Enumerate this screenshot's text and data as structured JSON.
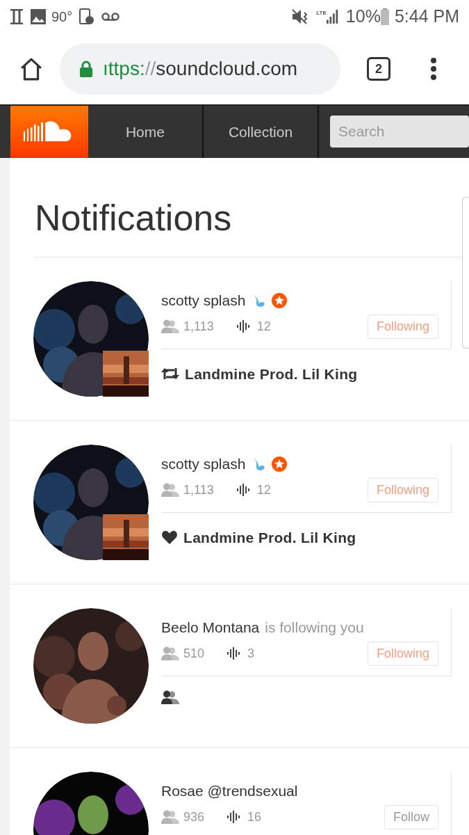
{
  "status_bar": {
    "temperature": "90°",
    "network": "LTE",
    "battery": "10%",
    "time": "5:44 PM"
  },
  "browser": {
    "url_scheme": "ıttps:",
    "url_sep": "//",
    "url_host": "soundcloud.com",
    "tab_count": "2"
  },
  "nav": {
    "items": [
      {
        "label": "Home",
        "selected": false
      },
      {
        "label": "Collection",
        "selected": false
      }
    ],
    "search": {
      "placeholder": "Search"
    }
  },
  "page": {
    "title": "Notifications"
  },
  "notifications": [
    {
      "name": "scotty splash",
      "badges": [
        {
          "kind": "drop"
        },
        {
          "kind": "pro"
        }
      ],
      "followers": "1,113",
      "tracks": "12",
      "following": true,
      "button": "Following",
      "activity": {
        "kind": "repost",
        "text": "Landmine Prod. Lil King"
      },
      "cover": true
    },
    {
      "name": "scotty splash",
      "badges": [
        {
          "kind": "drop"
        },
        {
          "kind": "pro"
        }
      ],
      "followers": "1,113",
      "tracks": "12",
      "following": true,
      "button": "Following",
      "activity": {
        "kind": "like",
        "text": "Landmine Prod. Lil King"
      },
      "cover": true
    },
    {
      "name": "Beelo Montana",
      "suffix": "is following you",
      "followers": "510",
      "tracks": "3",
      "following": true,
      "button": "Following",
      "activity": {
        "kind": "follow"
      },
      "cover": false
    },
    {
      "name": "Rosae @trendsexual",
      "followers": "936",
      "tracks": "16",
      "following": false,
      "button": "Follow",
      "cover": false
    }
  ]
}
